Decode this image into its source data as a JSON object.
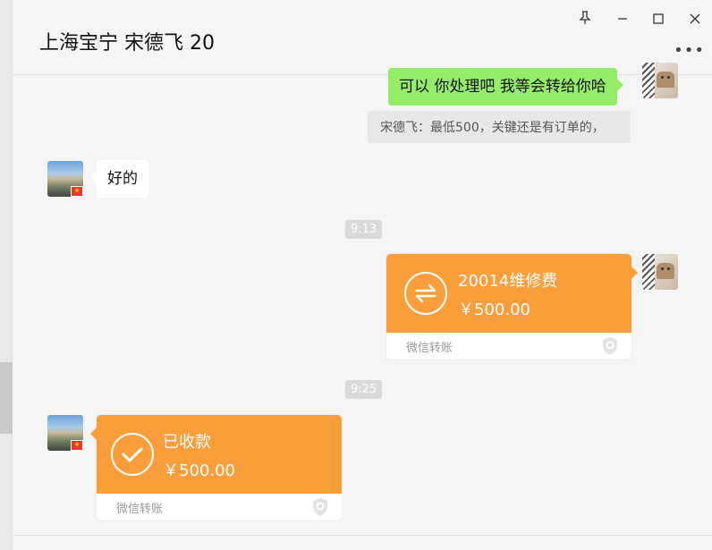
{
  "window": {
    "title": "上海宝宁 宋德飞 20",
    "controls": {
      "pin": "pin-icon",
      "minimize": "minimize-icon",
      "maximize": "maximize-icon",
      "close": "close-icon",
      "more": "more-icon"
    }
  },
  "messages": {
    "sent_text": "可以  你处理吧 我等会转给你哈",
    "quote_text": "宋德飞：最低500，关键还是有订单的，",
    "received_text": "好的",
    "time_1": "9:13",
    "transfer_sent": {
      "title": "20014维修费",
      "amount": "￥500.00",
      "label": "微信转账"
    },
    "time_2": "9:25",
    "transfer_received": {
      "title": "已收款",
      "amount": "￥500.00",
      "label": "微信转账"
    }
  },
  "colors": {
    "green_bubble": "#95ec69",
    "transfer_orange": "#fa9d3b",
    "background": "#f5f5f5"
  }
}
